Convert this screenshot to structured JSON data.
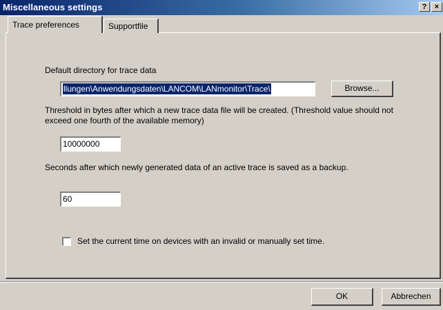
{
  "window": {
    "title": "Miscellaneous settings",
    "help_glyph": "?",
    "close_glyph": "×"
  },
  "tabs": [
    {
      "label": "Trace preferences",
      "active": true
    },
    {
      "label": "Supportfile",
      "active": false
    }
  ],
  "trace": {
    "directory_label": "Default directory for trace data",
    "directory_value": "llungen\\Anwendungsdaten\\LANCOM\\LANmonitor\\Trace\\",
    "browse_label": "Browse...",
    "threshold_label": "Threshold in bytes after which a new trace data file will be created. (Threshold value should not exceed one fourth of the available memory)",
    "threshold_value": "10000000",
    "seconds_label": "Seconds after which newly generated data of an active trace is saved as a backup.",
    "seconds_value": "60",
    "set_time_label": "Set the current time on devices with an invalid or manually set time.",
    "set_time_checked": false
  },
  "footer": {
    "ok_label": "OK",
    "cancel_label": "Abbrechen"
  },
  "colors": {
    "titlebar_start": "#0a246a",
    "titlebar_end": "#a6caf0",
    "dialog_bg": "#d4d0c8",
    "selection": "#0a246a"
  }
}
